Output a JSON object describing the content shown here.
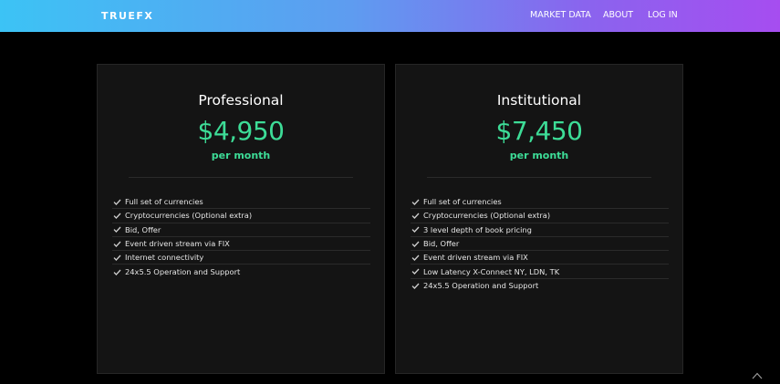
{
  "header": {
    "logo": "TRUEFX",
    "nav": [
      "MARKET DATA",
      "ABOUT",
      "LOG IN"
    ]
  },
  "plans": [
    {
      "name": "Professional",
      "price": "$4,950",
      "period": "per month",
      "features": [
        "Full set of currencies",
        "Cryptocurrencies (Optional extra)",
        "Bid, Offer",
        "Event driven stream via FIX",
        "Internet connectivity",
        "24x5.5 Operation and Support"
      ]
    },
    {
      "name": "Institutional",
      "price": "$7,450",
      "period": "per month",
      "features": [
        "Full set of currencies",
        "Cryptocurrencies (Optional extra)",
        "3 level depth of book pricing",
        "Bid, Offer",
        "Event driven stream via FIX",
        "Low Latency X-Connect NY, LDN, TK",
        "24x5.5 Operation and Support"
      ]
    }
  ],
  "icons": {
    "feature": "check-icon",
    "scroll": "chevron-up-icon"
  },
  "colors": {
    "accent": "#3ddc97",
    "header_start": "#3cc3f5",
    "header_end": "#a64df0",
    "card_bg": "#141414",
    "page_bg": "#000000"
  }
}
